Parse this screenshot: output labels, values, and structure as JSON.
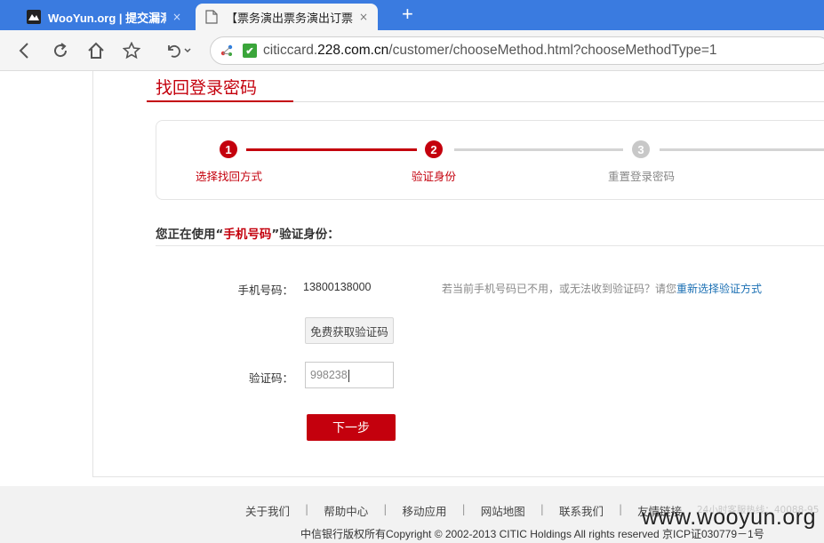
{
  "browser": {
    "tabs": [
      {
        "title": "WooYun.org | 提交漏洞",
        "close": "×",
        "favicon": "wooyun-logo-icon"
      },
      {
        "title": "【票务演出票务演出订票票",
        "close": "×",
        "favicon": "page-icon"
      }
    ],
    "new_tab": "+",
    "address": {
      "prefix": "citiccard.",
      "domain": "228.com.cn",
      "path": "/customer/chooseMethod.html?chooseMethodType=1"
    },
    "colors": {
      "tabbar": "#3a7be0",
      "secure": "#3aa53a"
    }
  },
  "page": {
    "heading": "找回登录密码",
    "steps": [
      {
        "number": "1",
        "label": "选择找回方式",
        "state": "done"
      },
      {
        "number": "2",
        "label": "验证身份",
        "state": "current"
      },
      {
        "number": "3",
        "label": "重置登录密码",
        "state": "pending"
      }
    ],
    "section_title": {
      "before": "您正在使用“",
      "highlight": "手机号码",
      "after": "”验证身份："
    },
    "phone_label": "手机号码：",
    "phone_value": "13800138000",
    "hint_text": "若当前手机号码已不用，或无法收到验证码？请您",
    "hint_link": "重新选择验证方式",
    "sms_button": "免费获取验证码",
    "code_label": "验证码：",
    "code_value": "998238",
    "next_button": "下一步",
    "accent_color": "#c4000d"
  },
  "footer": {
    "links": [
      "关于我们",
      "帮助中心",
      "移动应用",
      "网站地图",
      "联系我们",
      "友情链接"
    ],
    "separator": "|",
    "hotline": "24小时客服热线：40088-95",
    "copyright": "中信银行版权所有Copyright © 2002-2013 CITIC Holdings All rights reserved 京ICP证030779－1号"
  },
  "watermark": "www.wooyun.org"
}
